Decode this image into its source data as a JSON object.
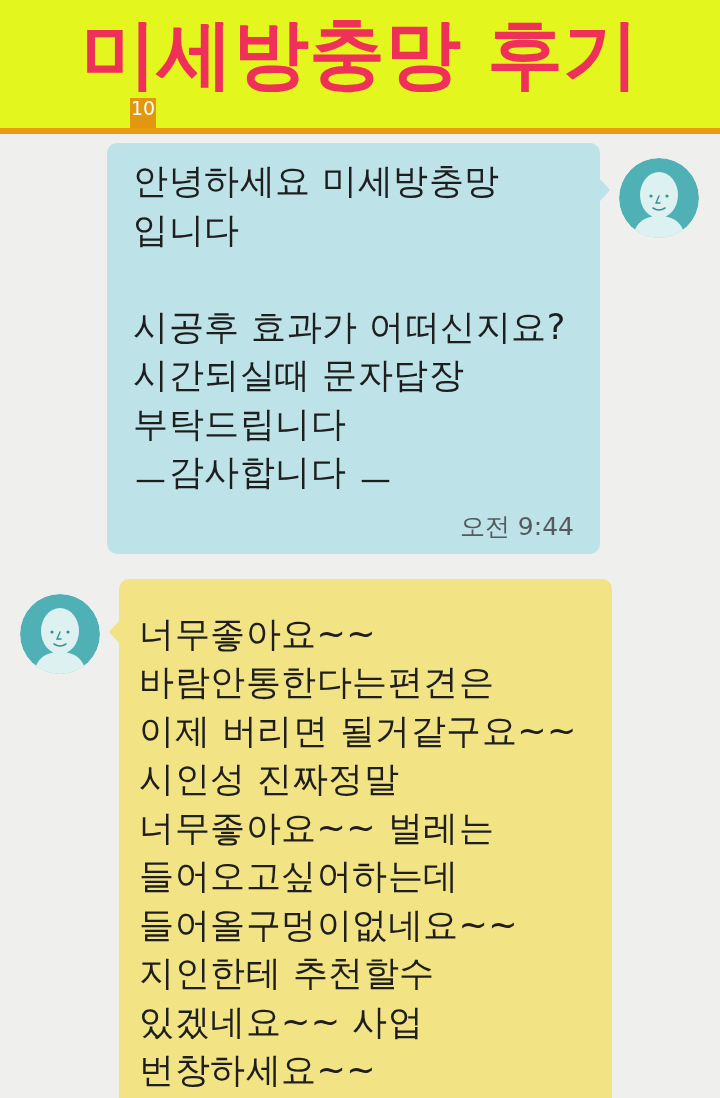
{
  "header": {
    "title": "미세방충망 후기",
    "badge": "10"
  },
  "messages": [
    {
      "kind": "outgoing",
      "text": "안녕하세요 미세방충망\n입니다\n\n시공후 효과가 어떠신지요?\n시간되실때 문자답장\n부탁드립니다\nㅡ감사합니다 ㅡ",
      "time": "오전 9:44"
    },
    {
      "kind": "incoming",
      "text": "너무좋아요~~\n바람안통한다는편견은\n이제 버리면 될거같구요~~\n시인성 진짜정말\n너무좋아요~~ 벌레는\n들어오고싶어하는데\n들어올구멍이없네요~~\n지인한테 추천할수\n있겠네요~~ 사업\n번창하세요~~"
    }
  ]
}
